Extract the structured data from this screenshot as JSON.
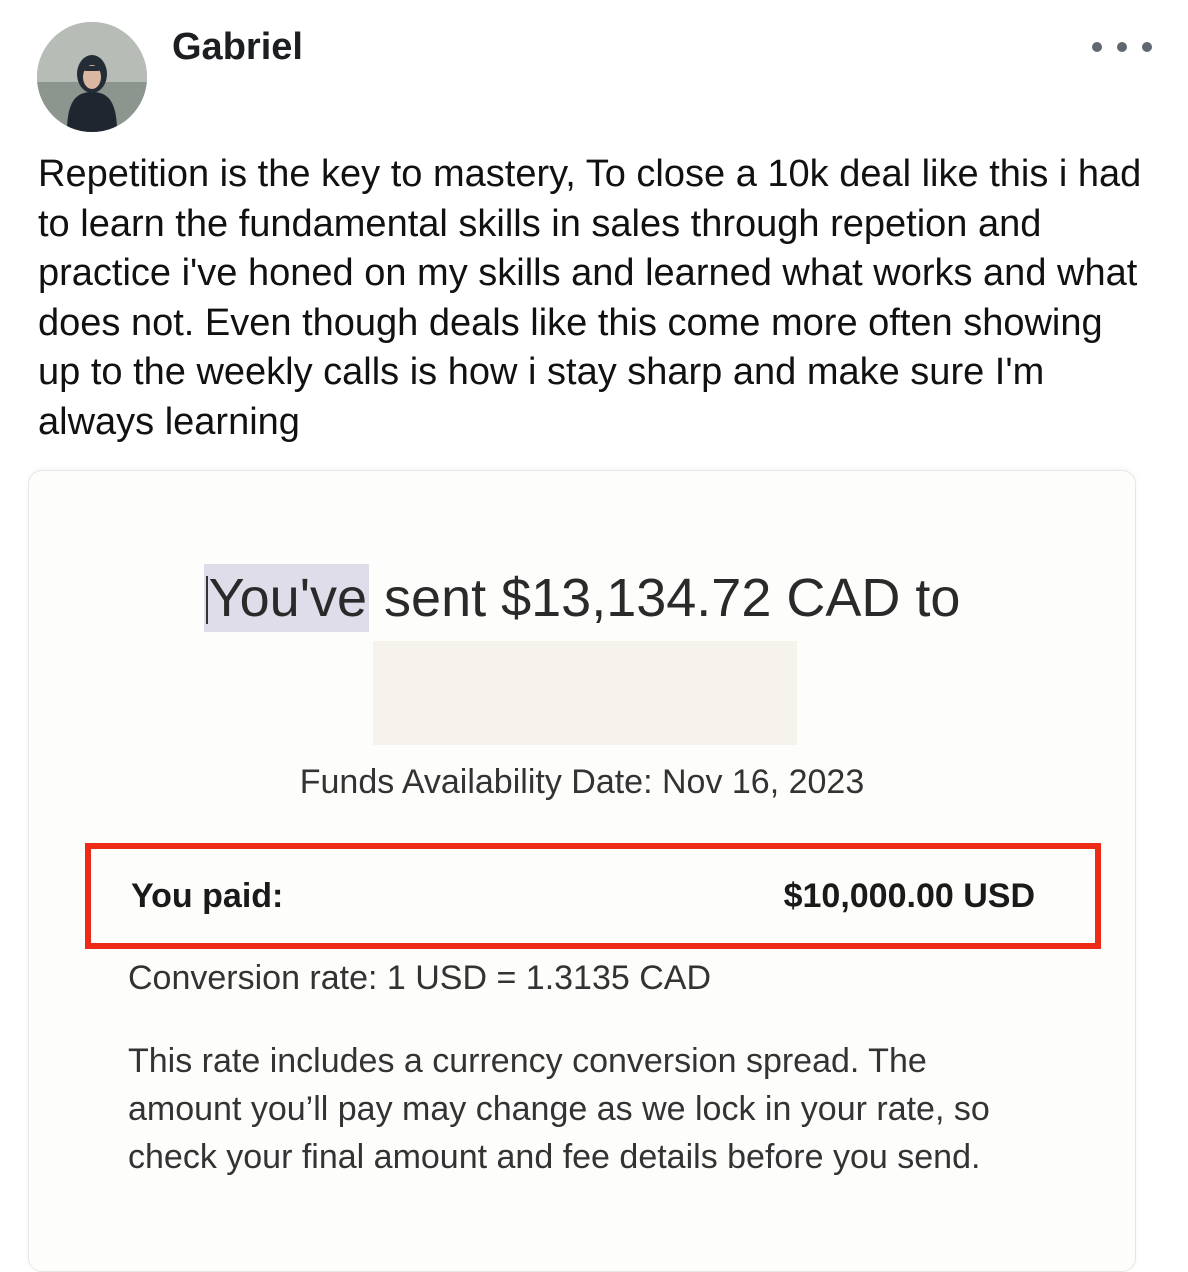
{
  "post": {
    "author": "Gabriel",
    "body": "Repetition is the key to mastery, To close a 10k deal like this i had to learn the fundamental skills in sales through repetion and practice i've honed on my skills and learned what works and what does not. Even though deals like this come more often showing up to the weekly calls is how i stay sharp and make sure I'm always learning"
  },
  "receipt": {
    "sent_highlight": "You've",
    "sent_rest": " sent $13,134.72 CAD to",
    "funds_availability": "Funds Availability Date: Nov 16, 2023",
    "paid_label": "You paid:",
    "paid_value": "$10,000.00 USD",
    "conversion_rate": "Conversion rate: 1 USD = 1.3135 CAD",
    "disclaimer": "This rate includes a currency conversion spread. The amount you’ll pay may change as we lock in your rate, so check your final amount and fee details before you send.",
    "highlight_box_color": "#ec2a16"
  },
  "icons": {
    "more": "more-horizontal-icon",
    "avatar": "profile-photo"
  }
}
